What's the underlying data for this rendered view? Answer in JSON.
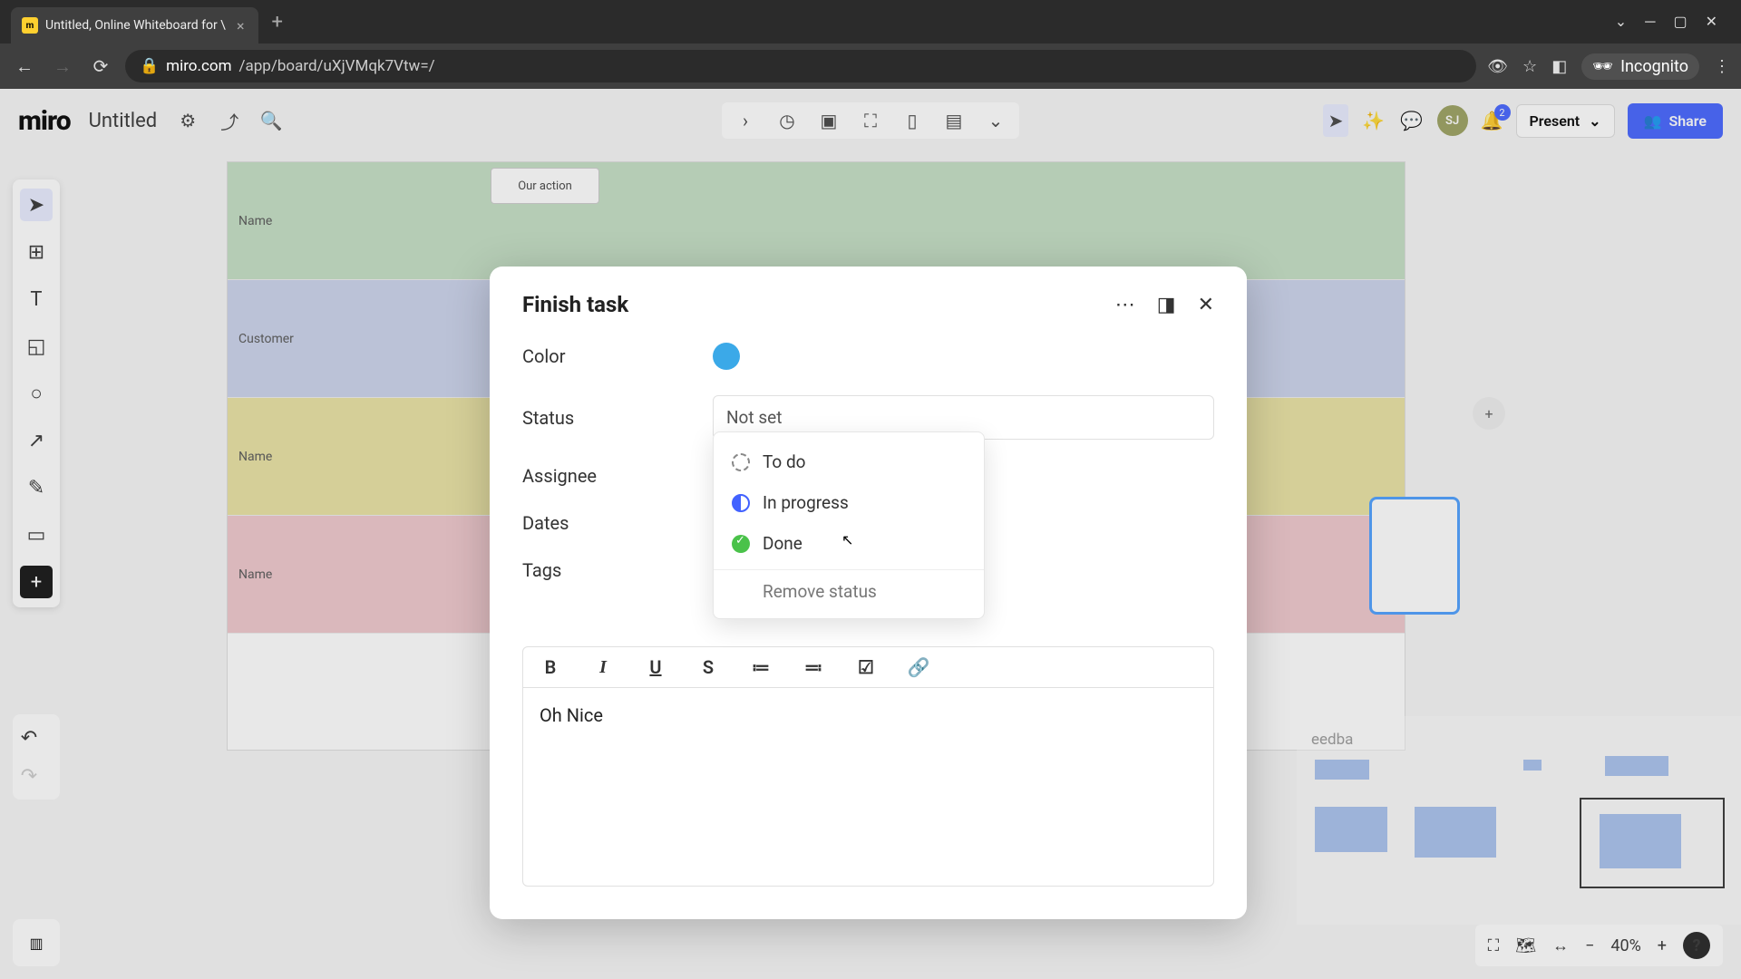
{
  "browser": {
    "tab_title": "Untitled, Online Whiteboard for \\",
    "url_prefix": "miro.com",
    "url_path": "/app/board/uXjVMqk7Vtw=/",
    "incognito_label": "Incognito"
  },
  "header": {
    "logo": "miro",
    "board_name": "Untitled",
    "present_label": "Present",
    "share_label": "Share",
    "avatar_initials": "SJ",
    "notif_count": "2"
  },
  "canvas": {
    "row_labels": [
      "Name",
      "Customer",
      "Name",
      "Name"
    ],
    "action_label": "Our action",
    "feedback_text": "eedba"
  },
  "modal": {
    "title": "Finish task",
    "fields": {
      "color": "Color",
      "status": "Status",
      "assignee": "Assignee",
      "dates": "Dates",
      "tags": "Tags"
    },
    "status_value": "Not set",
    "status_options": {
      "todo": "To do",
      "in_progress": "In progress",
      "done": "Done",
      "remove": "Remove status"
    },
    "color_value": "#3ba9e8",
    "editor_content": "Oh Nice"
  },
  "zoom": {
    "value": "40%"
  }
}
